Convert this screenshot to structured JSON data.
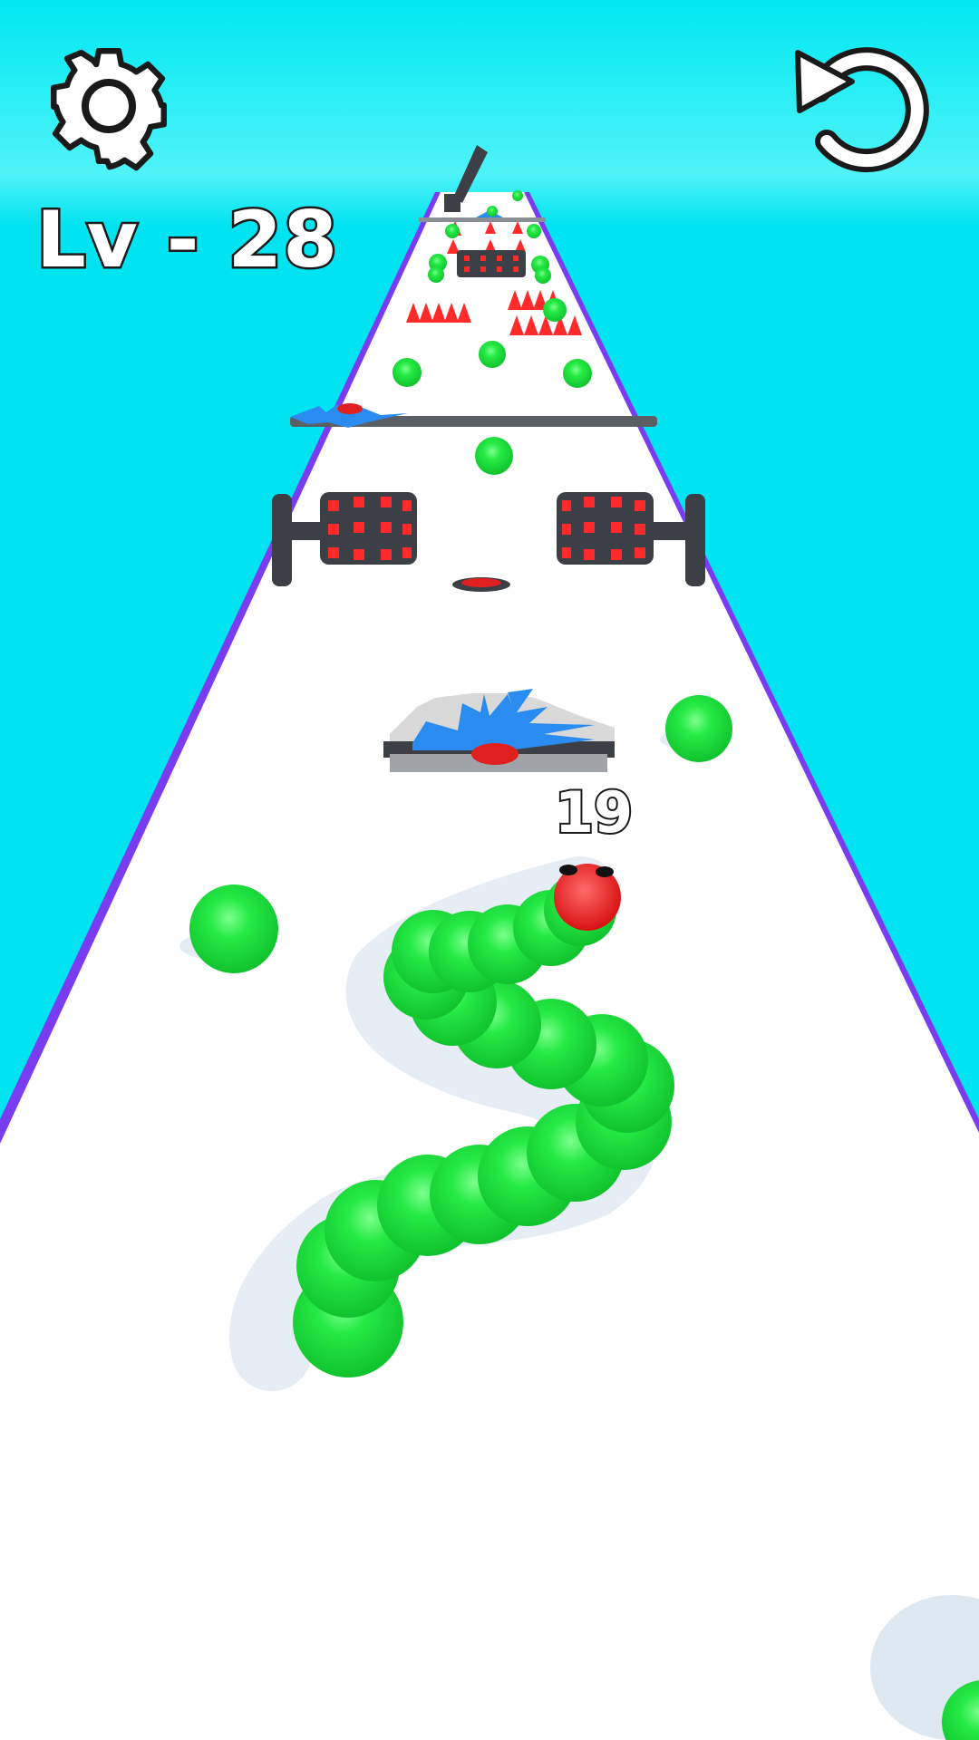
{
  "hud": {
    "level_label": "Lv - 28",
    "settings_icon": "gear-icon",
    "restart_icon": "restart-icon"
  },
  "player": {
    "snake_length": "19"
  },
  "colors": {
    "sky": "#00e5f0",
    "track": "#ffffff",
    "rail": "#7a3cf0",
    "ball": "#19e63c",
    "spike": "#ff2a2a",
    "saw": "#2a8cf0",
    "metal": "#3c4046"
  }
}
